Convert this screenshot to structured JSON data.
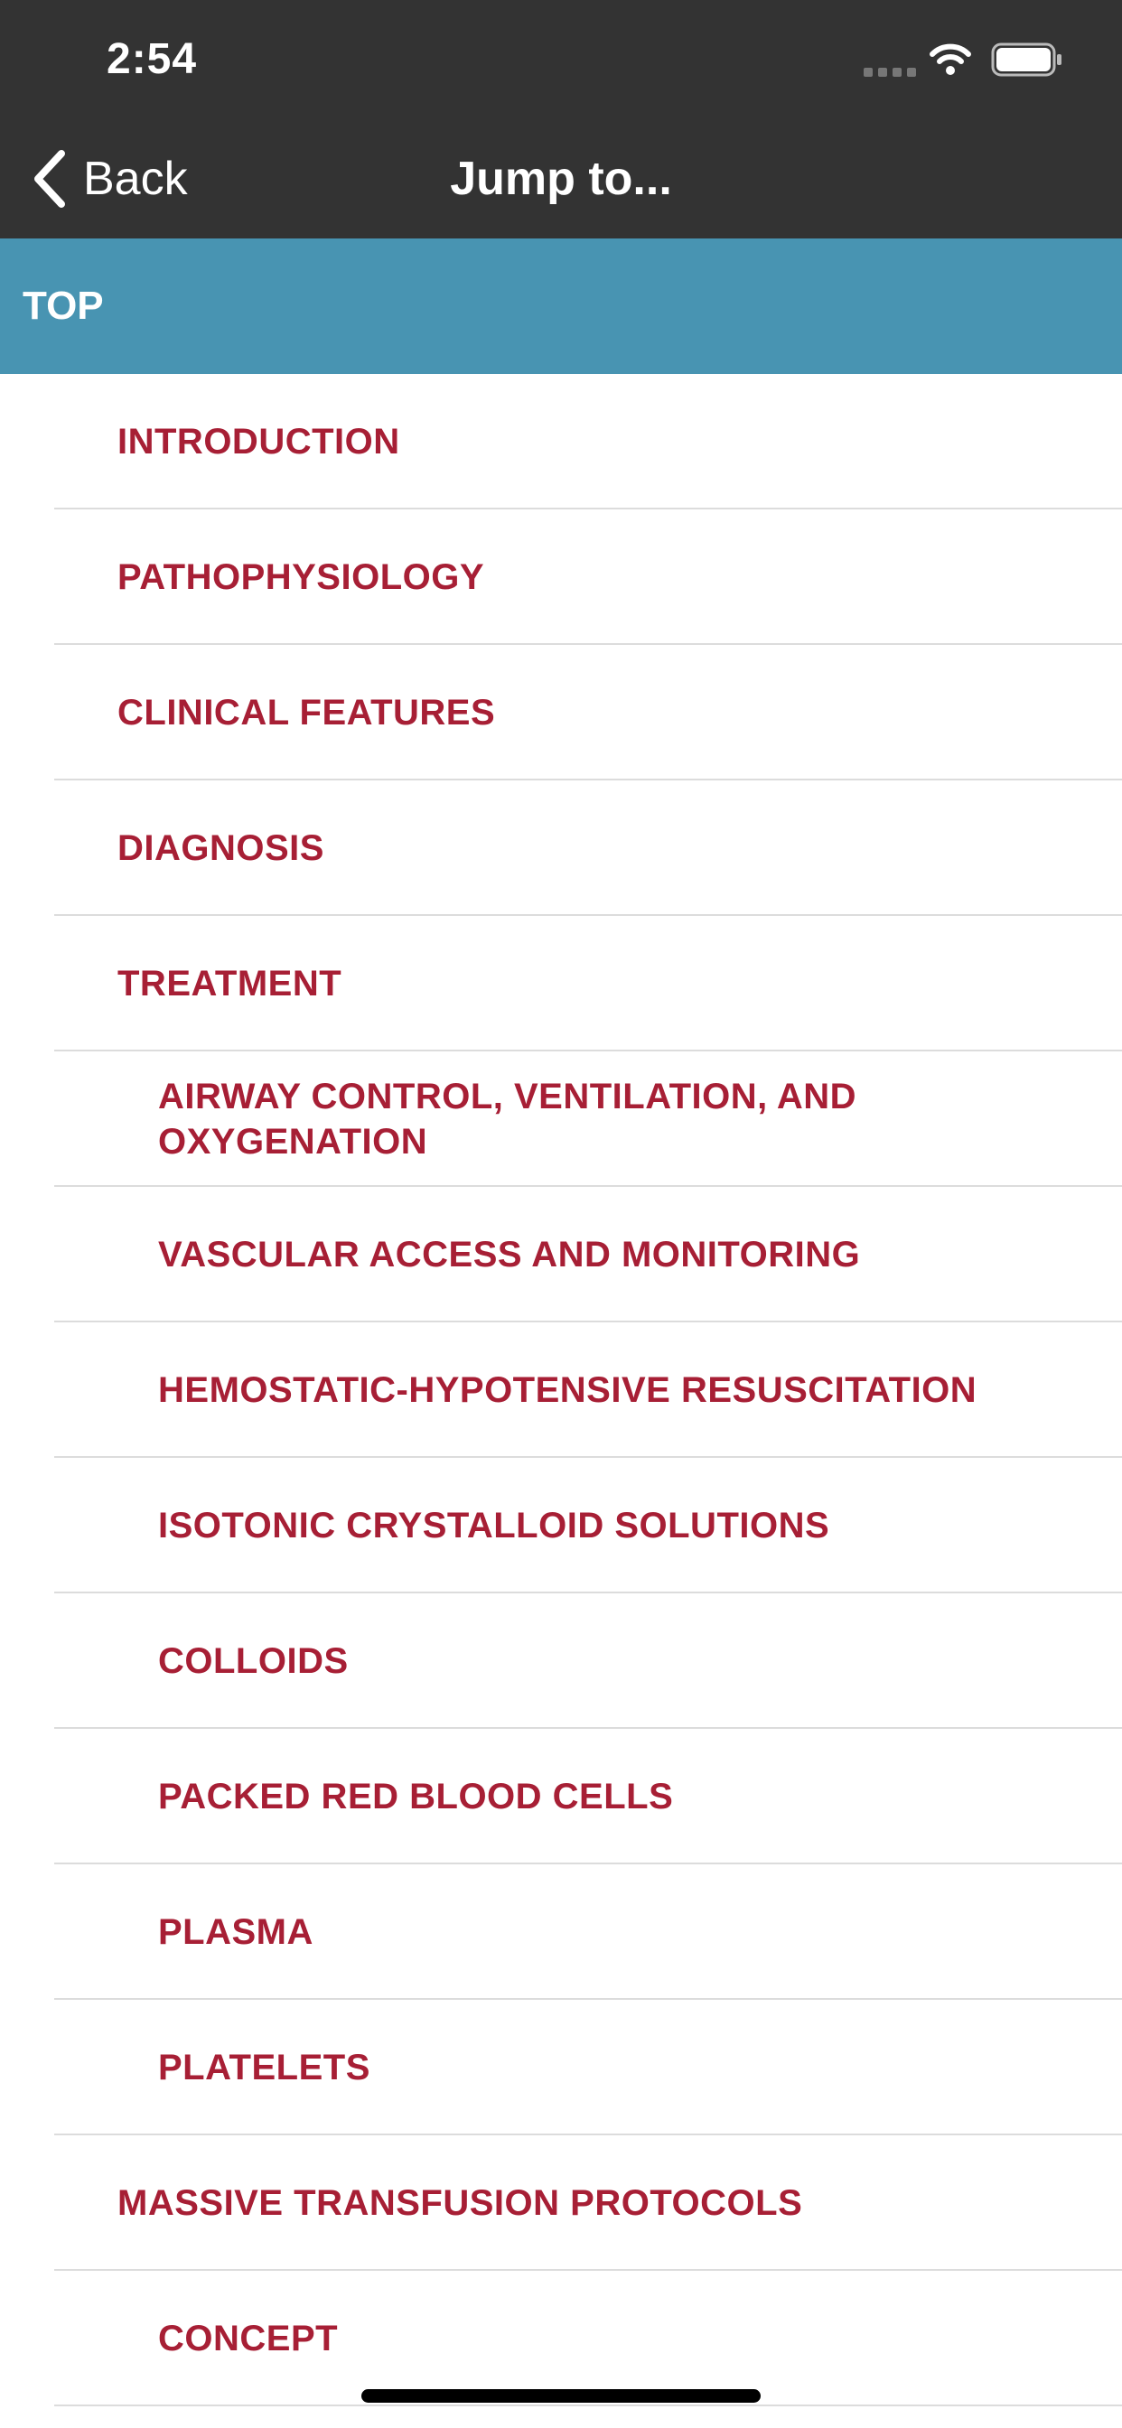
{
  "status_bar": {
    "time": "2:54",
    "icons": [
      "signal-icon",
      "wifi-icon",
      "battery-icon"
    ]
  },
  "nav": {
    "back_label": "Back",
    "back_icon": "chevron-left-icon",
    "title": "Jump to..."
  },
  "top_item": {
    "label": "TOP"
  },
  "colors": {
    "header_bg": "#333333",
    "top_row_bg": "#4894b2",
    "link_red": "#a71f35",
    "divider": "#dcdcdc"
  },
  "toc": [
    {
      "label": "INTRODUCTION",
      "level": 1
    },
    {
      "label": "PATHOPHYSIOLOGY",
      "level": 1
    },
    {
      "label": "CLINICAL FEATURES",
      "level": 1
    },
    {
      "label": "DIAGNOSIS",
      "level": 1
    },
    {
      "label": "TREATMENT",
      "level": 1
    },
    {
      "label": "AIRWAY CONTROL, VENTILATION, AND OXYGENATION",
      "level": 2
    },
    {
      "label": "VASCULAR ACCESS AND MONITORING",
      "level": 2
    },
    {
      "label": "HEMOSTATIC-HYPOTENSIVE RESUSCITATION",
      "level": 2
    },
    {
      "label": "ISOTONIC CRYSTALLOID SOLUTIONS",
      "level": 2
    },
    {
      "label": "COLLOIDS",
      "level": 2
    },
    {
      "label": "PACKED RED BLOOD CELLS",
      "level": 2
    },
    {
      "label": "PLASMA",
      "level": 2
    },
    {
      "label": "PLATELETS",
      "level": 2
    },
    {
      "label": "MASSIVE TRANSFUSION PROTOCOLS",
      "level": 1
    },
    {
      "label": "CONCEPT",
      "level": 2
    }
  ]
}
